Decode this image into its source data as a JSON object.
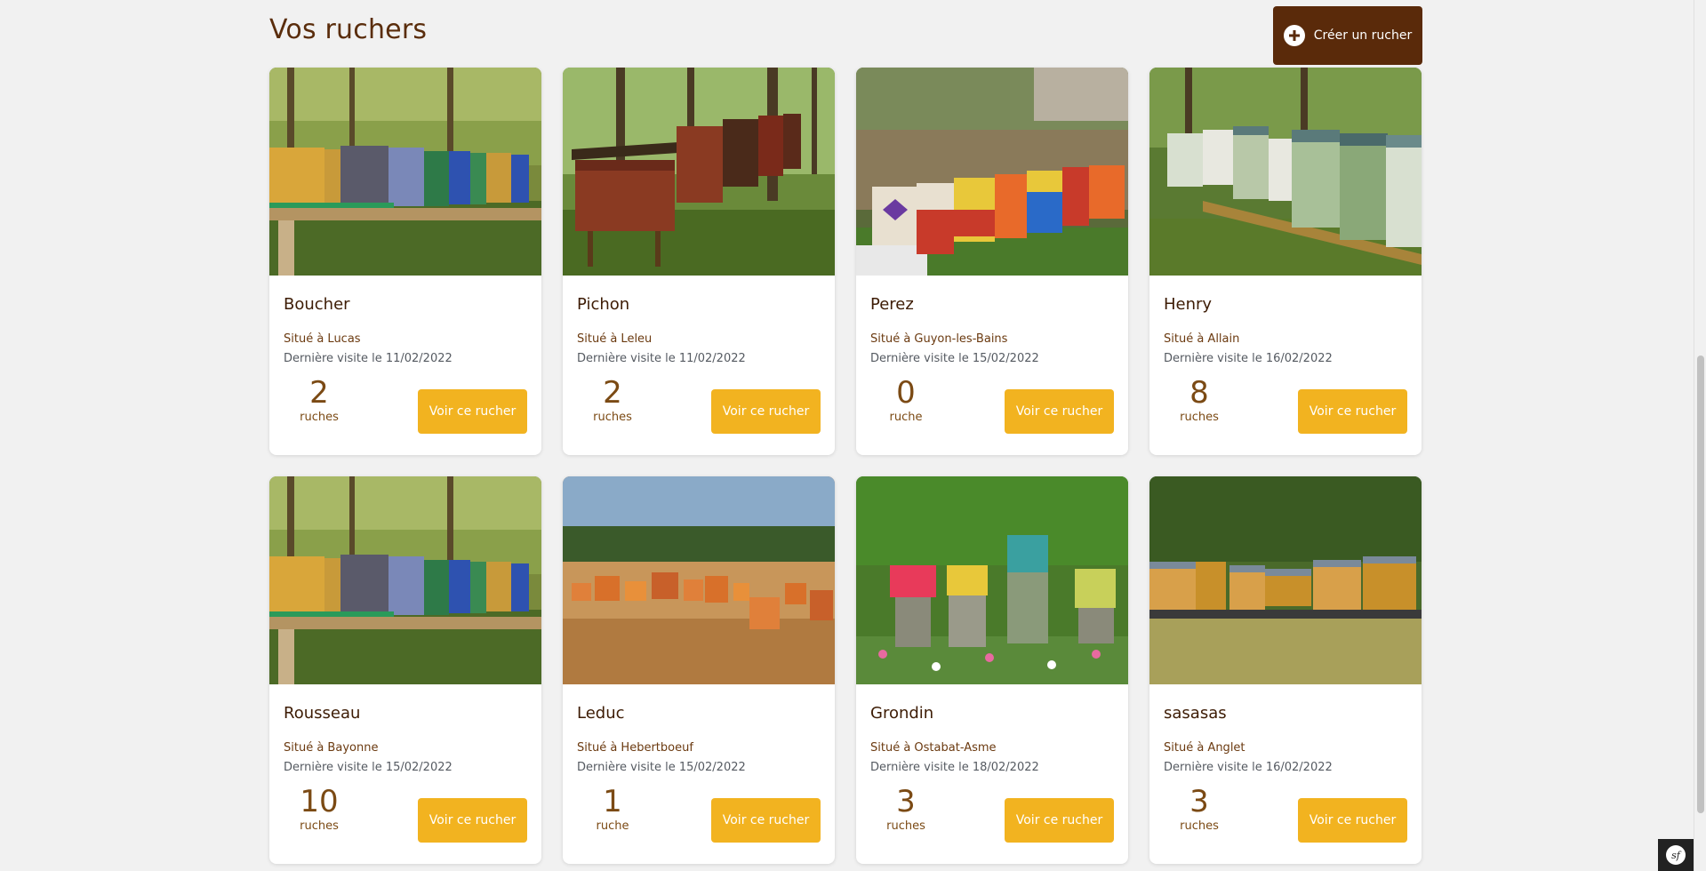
{
  "page": {
    "title": "Vos ruchers",
    "create_button_label": "Créer un rucher"
  },
  "apiaries": [
    {
      "name": "Boucher",
      "location": "Situé à Lucas",
      "last_visit": "Dernière visite le 11/02/2022",
      "hive_count": "2",
      "hive_unit": "ruches",
      "button_label": "Voir ce rucher",
      "image": "row of colorful hives on wooden stand in forest"
    },
    {
      "name": "Pichon",
      "location": "Situé à Leleu",
      "last_visit": "Dernière visite le 11/02/2022",
      "hive_count": "2",
      "hive_unit": "ruches",
      "button_label": "Voir ce rucher",
      "image": "red wooden hives in woodland"
    },
    {
      "name": "Perez",
      "location": "Situé à Guyon-les-Bains",
      "last_visit": "Dernière visite le 15/02/2022",
      "hive_count": "0",
      "hive_unit": "ruche",
      "button_label": "Voir ce rucher",
      "image": "painted hives with symbols in garden"
    },
    {
      "name": "Henry",
      "location": "Situé à Allain",
      "last_visit": "Dernière visite le 16/02/2022",
      "hive_count": "8",
      "hive_unit": "ruches",
      "button_label": "Voir ce rucher",
      "image": "green and white hives on stand"
    },
    {
      "name": "Rousseau",
      "location": "Situé à Bayonne",
      "last_visit": "Dernière visite le 15/02/2022",
      "hive_count": "10",
      "hive_unit": "ruches",
      "button_label": "Voir ce rucher",
      "image": "row of colorful hives on wooden stand in forest"
    },
    {
      "name": "Leduc",
      "location": "Situé à Hebertboeuf",
      "last_visit": "Dernière visite le 15/02/2022",
      "hive_count": "1",
      "hive_unit": "ruche",
      "button_label": "Voir ce rucher",
      "image": "orange hives in open field"
    },
    {
      "name": "Grondin",
      "location": "Situé à Ostabat-Asme",
      "last_visit": "Dernière visite le 18/02/2022",
      "hive_count": "3",
      "hive_unit": "ruches",
      "button_label": "Voir ce rucher",
      "image": "colorful hives among wildflowers"
    },
    {
      "name": "sasasas",
      "location": "Situé à Anglet",
      "last_visit": "Dernière visite le 16/02/2022",
      "hive_count": "3",
      "hive_unit": "ruches",
      "button_label": "Voir ce rucher",
      "image": "wooden hives in grassy meadow"
    }
  ],
  "colors": {
    "brand_dark": "#5a2a0a",
    "button_yellow": "#f2b320",
    "background": "#f1f1f1"
  },
  "icons": {
    "create": "plus-circle-icon",
    "debug_toolbar": "symfony-icon"
  }
}
